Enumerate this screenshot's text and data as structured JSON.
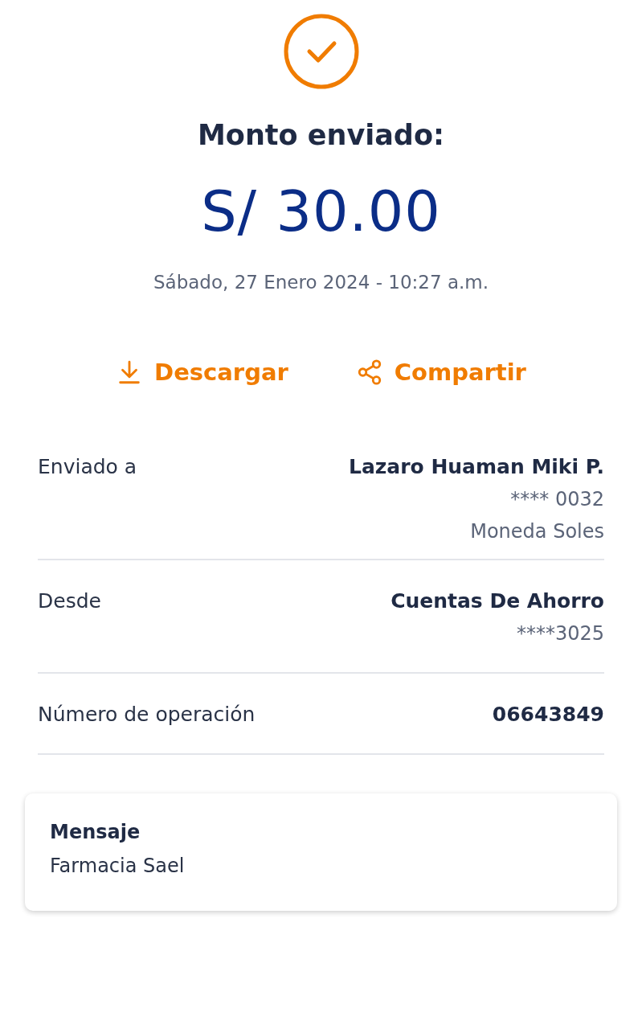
{
  "title": "Monto enviado:",
  "amount": "S/ 30.00",
  "date": "Sábado, 27 Enero 2024 - 10:27 a.m.",
  "actions": [
    {
      "label": "Descargar",
      "kind": "download"
    },
    {
      "label": "Compartir",
      "kind": "share"
    }
  ],
  "details": [
    {
      "label": "Enviado a",
      "values": [
        {
          "text": "Lazaro Huaman Miki P.",
          "kind": "strong"
        },
        {
          "text": "**** 0032",
          "kind": "plain"
        },
        {
          "text": "Moneda Soles",
          "kind": "plain"
        }
      ]
    },
    {
      "label": "Desde",
      "values": [
        {
          "text": "Cuentas De Ahorro",
          "kind": "strong"
        },
        {
          "text": "****3025",
          "kind": "plain"
        }
      ]
    },
    {
      "label": "Número de operación",
      "values": [
        {
          "text": "06643849",
          "kind": "strong"
        }
      ]
    }
  ],
  "message": {
    "title": "Mensaje",
    "text": "Farmacia Sael"
  }
}
